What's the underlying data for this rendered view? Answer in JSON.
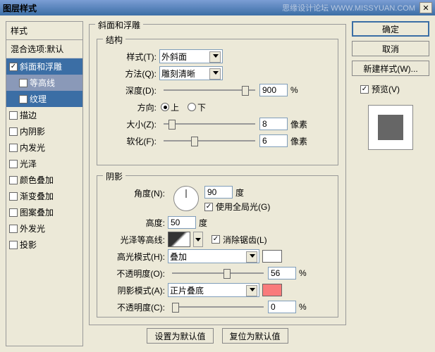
{
  "window": {
    "title": "图层样式",
    "watermark": "思缘设计论坛  WWW.MISSYUAN.COM"
  },
  "left": {
    "header": "样式",
    "blend": "混合选项:默认",
    "items": [
      {
        "label": "斜面和浮雕",
        "checked": true,
        "selected": true
      },
      {
        "label": "等高线",
        "checked": false,
        "sub": true
      },
      {
        "label": "纹理",
        "checked": false,
        "sub": true,
        "selected": true
      },
      {
        "label": "描边",
        "checked": false
      },
      {
        "label": "内阴影",
        "checked": false
      },
      {
        "label": "内发光",
        "checked": false
      },
      {
        "label": "光泽",
        "checked": false
      },
      {
        "label": "颜色叠加",
        "checked": false
      },
      {
        "label": "渐变叠加",
        "checked": false
      },
      {
        "label": "图案叠加",
        "checked": false
      },
      {
        "label": "外发光",
        "checked": false
      },
      {
        "label": "投影",
        "checked": false
      }
    ]
  },
  "bevel": {
    "title": "斜面和浮雕",
    "struct_title": "结构",
    "style_label": "样式(T):",
    "style_value": "外斜面",
    "technique_label": "方法(Q):",
    "technique_value": "雕刻清晰",
    "depth_label": "深度(D):",
    "depth_value": "900",
    "depth_unit": "%",
    "direction_label": "方向:",
    "up": "上",
    "down": "下",
    "size_label": "大小(Z):",
    "size_value": "8",
    "size_unit": "像素",
    "soften_label": "软化(F):",
    "soften_value": "6",
    "soften_unit": "像素",
    "shadow_title": "阴影",
    "angle_label": "角度(N):",
    "angle_value": "90",
    "angle_unit": "度",
    "global_light": "使用全局光(G)",
    "altitude_label": "高度:",
    "altitude_value": "50",
    "altitude_unit": "度",
    "gloss_label": "光泽等高线:",
    "antialias": "消除锯齿(L)",
    "highlight_mode_label": "高光模式(H):",
    "highlight_mode": "叠加",
    "highlight_color": "#FFFFFF",
    "highlight_opacity_label": "不透明度(O):",
    "highlight_opacity": "56",
    "opacity_unit": "%",
    "shadow_mode_label": "阴影模式(A):",
    "shadow_mode": "正片叠底",
    "shadow_color": "#F97B7B",
    "shadow_opacity_label": "不透明度(C):",
    "shadow_opacity": "0"
  },
  "buttons": {
    "make_default": "设置为默认值",
    "reset_default": "复位为默认值",
    "ok": "确定",
    "cancel": "取消",
    "new_style": "新建样式(W)...",
    "preview": "预览(V)"
  }
}
